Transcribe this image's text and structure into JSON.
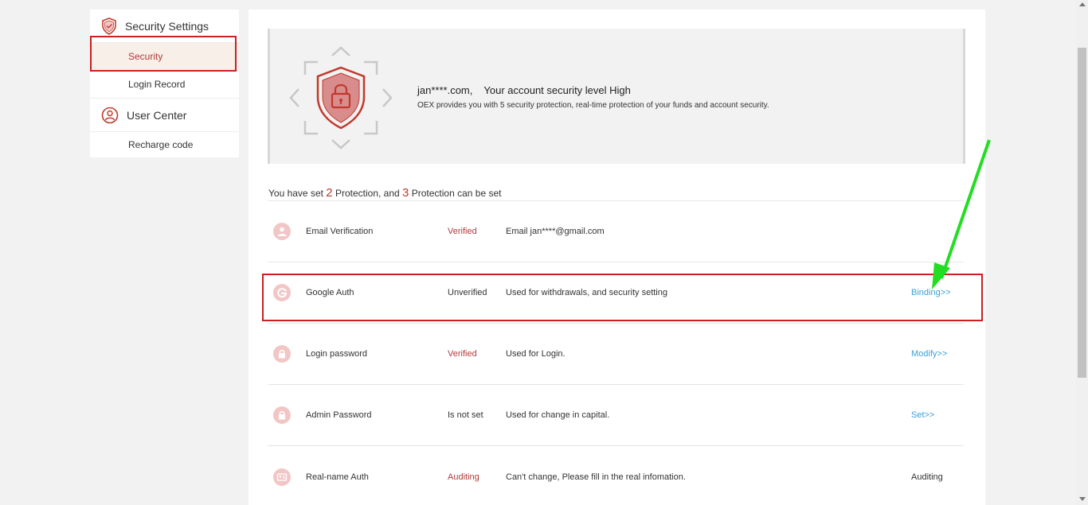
{
  "sidebar": {
    "security_settings": "Security Settings",
    "security": "Security",
    "login_record": "Login Record",
    "user_center": "User Center",
    "recharge_code": "Recharge code"
  },
  "banner": {
    "account": "jan****.com,",
    "level_text": "Your account security level High",
    "description": "OEX provides you with 5 security protection, real-time protection of your funds and account security."
  },
  "summary": {
    "prefix": "You have set",
    "set_count": "2",
    "middle": "Protection, and",
    "remaining_count": "3",
    "suffix": "Protection can be set"
  },
  "rows": [
    {
      "icon": "user-icon",
      "name": "Email Verification",
      "status": "Verified",
      "description": "Email jan****@gmail.com",
      "action": ""
    },
    {
      "icon": "google-icon",
      "name": "Google Auth",
      "status": "Unverified",
      "description": "Used for withdrawals, and security setting",
      "action": "Binding>>"
    },
    {
      "icon": "lock-icon",
      "name": "Login password",
      "status": "Verified",
      "description": "Used for Login.",
      "action": "Modify>>"
    },
    {
      "icon": "lock-icon",
      "name": "Admin Password",
      "status": "Is not set",
      "description": "Used for change in capital.",
      "action": "Set>>"
    },
    {
      "icon": "id-card-icon",
      "name": "Real-name Auth",
      "status": "Auditing",
      "description": "Can't change, Please fill in the real infomation.",
      "action": "Auditing"
    }
  ],
  "colors": {
    "accent_red": "#b23a3a",
    "link_blue": "#3aa0d8",
    "highlight_red": "#cc1f1f",
    "annotation_green": "#22dd22"
  }
}
